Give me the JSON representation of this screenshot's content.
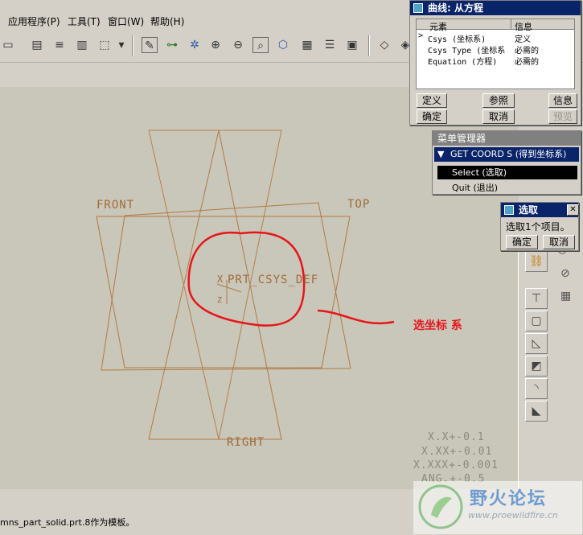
{
  "menu": {
    "app": "应用程序(P)",
    "tools": "工具(T)",
    "window": "窗口(W)",
    "help": "帮助(H)"
  },
  "datums": {
    "front": "FRONT",
    "top": "TOP",
    "right": "RIGHT",
    "csys": "PRT_CSYS_DEF",
    "csys_x": "X",
    "csys_z": "Z"
  },
  "annotation": "选坐标 系",
  "tolerances": [
    "X.X+-0.1",
    "X.XX+-0.01",
    "X.XXX+-0.001",
    "ANG.+-0.5"
  ],
  "status_text": "mns_part_solid.prt.8作为模板。",
  "curve_dialog": {
    "title": "曲线: 从方程",
    "col_element": "元素",
    "col_info": "信息",
    "rows": [
      {
        "element": "Csys (坐标系)",
        "info": "定义"
      },
      {
        "element": "Csys Type (坐标系",
        "info": "必需的"
      },
      {
        "element": "Equation (方程)",
        "info": "必需的"
      }
    ],
    "btn_define": "定义",
    "btn_ref": "参照",
    "btn_info": "信息",
    "btn_ok": "确定",
    "btn_cancel": "取消",
    "btn_preview": "预览"
  },
  "menu_manager": {
    "title": "菜单管理器",
    "header": "GET COORD S (得到坐标系)",
    "item_select": "Select (选取)",
    "item_quit": "Quit (退出)"
  },
  "select_dialog": {
    "title": "选取",
    "message": "选取1个项目。",
    "btn_ok": "确定",
    "btn_cancel": "取消"
  },
  "watermark": {
    "title": "野火论坛",
    "url": "www.proewildfire.cn"
  }
}
